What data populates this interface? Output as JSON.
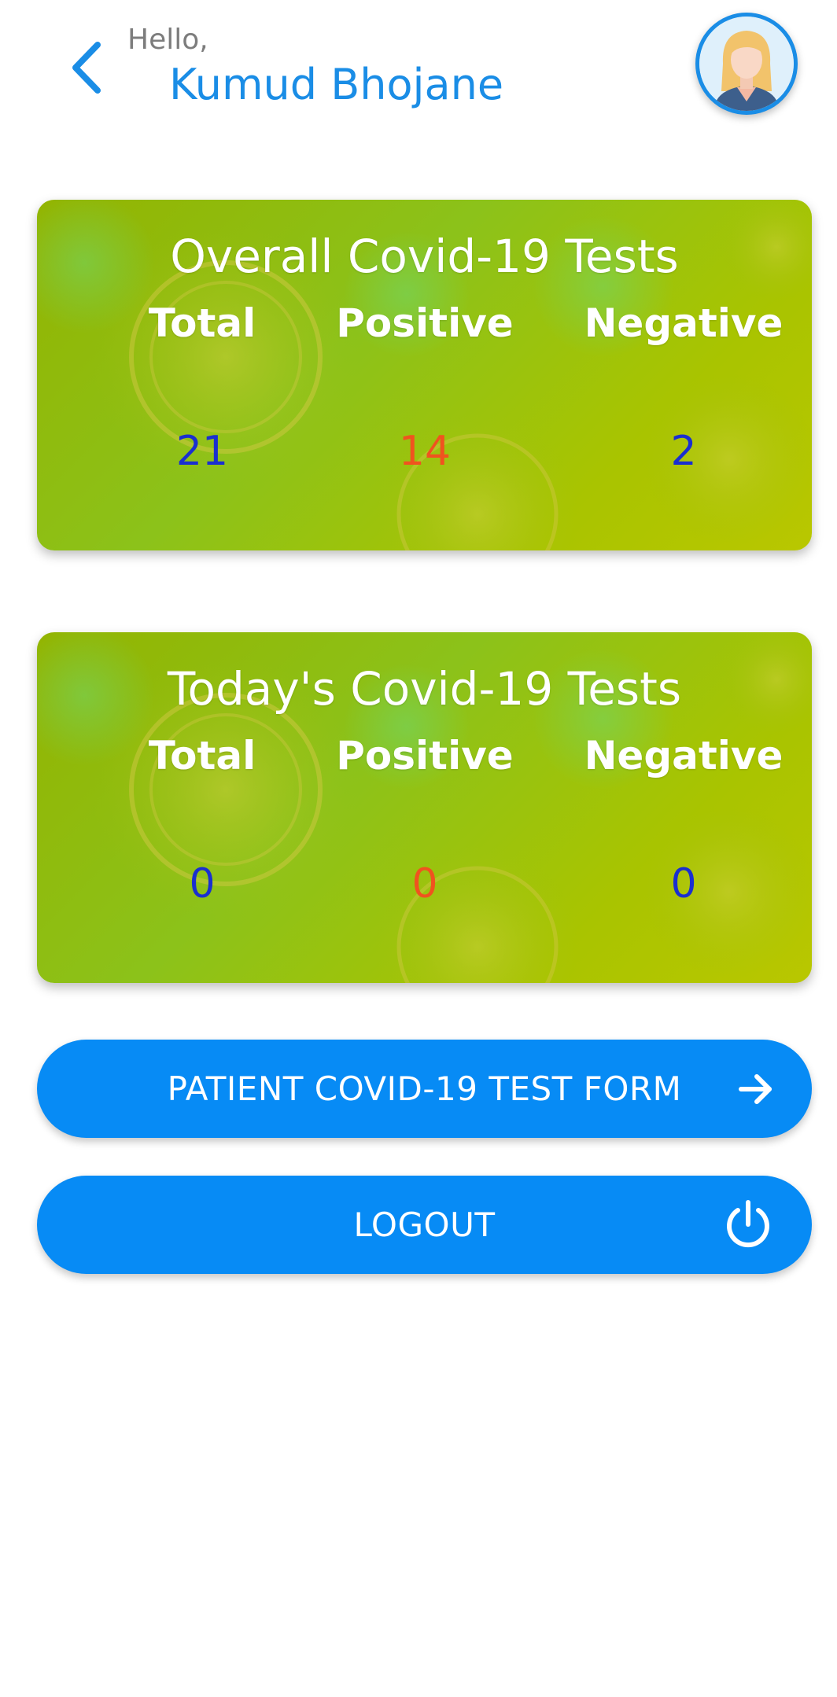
{
  "header": {
    "greeting": "Hello,",
    "username": "Kumud Bhojane",
    "back_icon": "chevron-left-icon",
    "avatar": "user-avatar"
  },
  "overall": {
    "title": "Overall Covid-19 Tests",
    "labels": {
      "total": "Total",
      "positive": "Positive",
      "negative": "Negative"
    },
    "values": {
      "total": "21",
      "positive": "14",
      "negative": "2"
    }
  },
  "today": {
    "title": "Today's Covid-19 Tests",
    "labels": {
      "total": "Total",
      "positive": "Positive",
      "negative": "Negative"
    },
    "values": {
      "total": "0",
      "positive": "0",
      "negative": "0"
    }
  },
  "actions": {
    "test_form_label": "PATIENT COVID-19 TEST FORM",
    "test_form_icon": "arrow-right-icon",
    "logout_label": "LOGOUT",
    "logout_icon": "power-icon"
  },
  "colors": {
    "accent": "#1a8de6",
    "button": "#078bf5",
    "card_green": "#8cc21a",
    "value_blue": "#1a2fd0",
    "value_orange": "#f0531f"
  }
}
